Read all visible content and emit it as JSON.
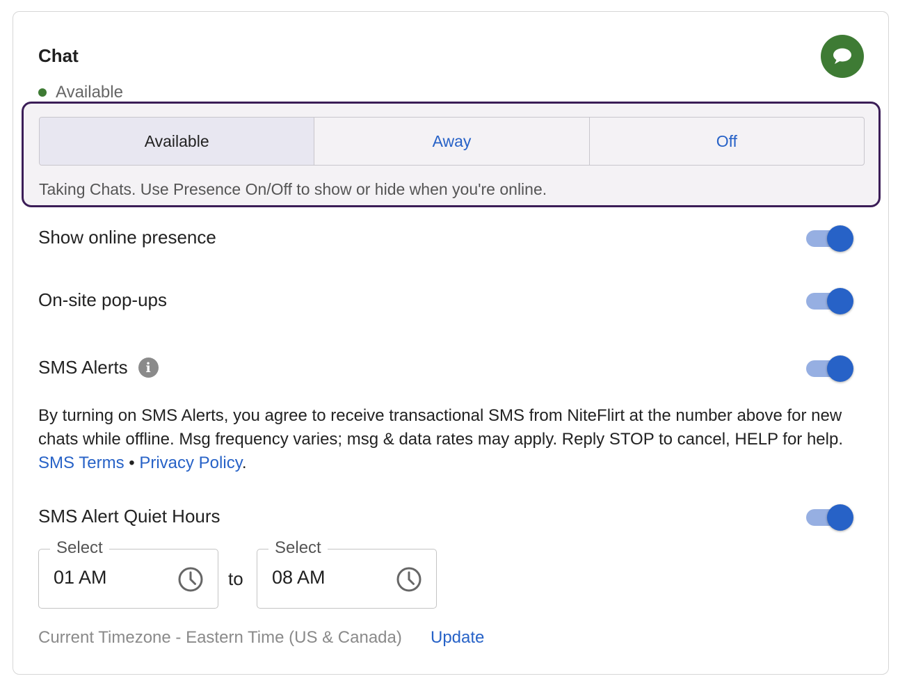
{
  "chat": {
    "title": "Chat",
    "status_text": "Available",
    "status_color": "#3e7b34",
    "chat_icon": "speech-bubble-icon"
  },
  "presence": {
    "options": [
      "Available",
      "Away",
      "Off"
    ],
    "selected": "Available",
    "hint": "Taking Chats. Use Presence On/Off to show or hide when you're online."
  },
  "settings": {
    "show_online_presence": {
      "label": "Show online presence",
      "enabled": true
    },
    "onsite_popups": {
      "label": "On-site pop-ups",
      "enabled": true
    },
    "sms_alerts": {
      "label": "SMS Alerts",
      "enabled": true,
      "info_icon": "info-icon"
    },
    "quiet_hours": {
      "label": "SMS Alert Quiet Hours",
      "enabled": true
    }
  },
  "disclaimer": {
    "text": "By turning on SMS Alerts, you agree to receive transactional SMS from NiteFlirt at the number above for new chats while offline. Msg frequency varies; msg & data rates may apply. Reply STOP to cancel, HELP for help.",
    "sms_terms_link": "SMS Terms",
    "separator": "•",
    "privacy_link": "Privacy Policy",
    "end": "."
  },
  "quiet_hours": {
    "start": {
      "legend": "Select",
      "value": "01 AM",
      "icon": "clock-icon"
    },
    "to_label": "to",
    "end": {
      "legend": "Select",
      "value": "08 AM",
      "icon": "clock-icon"
    }
  },
  "timezone": {
    "text": "Current Timezone - Eastern Time (US & Canada)",
    "update_label": "Update"
  },
  "colors": {
    "accent": "#2762c7",
    "toggle_track": "#96afe2",
    "presence_border": "#3b1d57",
    "chat_green": "#3e7b34"
  }
}
